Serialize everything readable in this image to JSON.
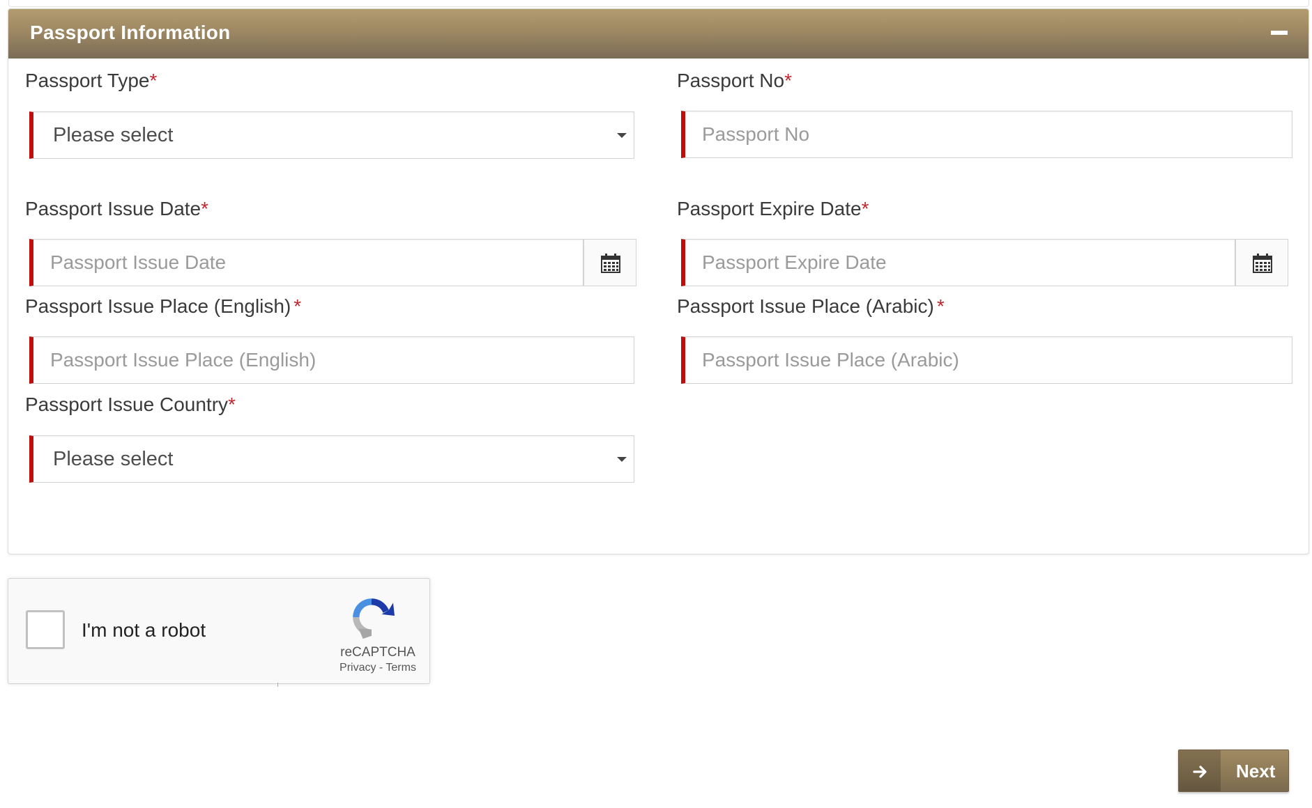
{
  "panel": {
    "title": "Passport Information"
  },
  "form": {
    "passport_type": {
      "label": "Passport Type",
      "required_mark": "*",
      "selected": "Please select"
    },
    "passport_no": {
      "label": "Passport No",
      "required_mark": "*",
      "placeholder": "Passport No"
    },
    "issue_date": {
      "label": "Passport Issue Date",
      "required_mark": "*",
      "placeholder": "Passport Issue Date"
    },
    "expire_date": {
      "label": "Passport Expire Date",
      "required_mark": "*",
      "placeholder": "Passport Expire Date"
    },
    "issue_place_en": {
      "label": "Passport Issue Place (English)",
      "required_mark": "*",
      "placeholder": "Passport Issue Place (English)"
    },
    "issue_place_ar": {
      "label": "Passport Issue Place (Arabic)",
      "required_mark": "*",
      "placeholder": "Passport Issue Place (Arabic)"
    },
    "issue_country": {
      "label": "Passport Issue Country",
      "required_mark": "*",
      "selected": "Please select"
    }
  },
  "recaptcha": {
    "label": "I'm not a robot",
    "brand": "reCAPTCHA",
    "privacy": "Privacy",
    "separator": " - ",
    "terms": "Terms"
  },
  "actions": {
    "next_label": "Next"
  },
  "colors": {
    "header_gold": "#9d8863",
    "required_red": "#c00d0d",
    "button_brown": "#8e7a57"
  }
}
